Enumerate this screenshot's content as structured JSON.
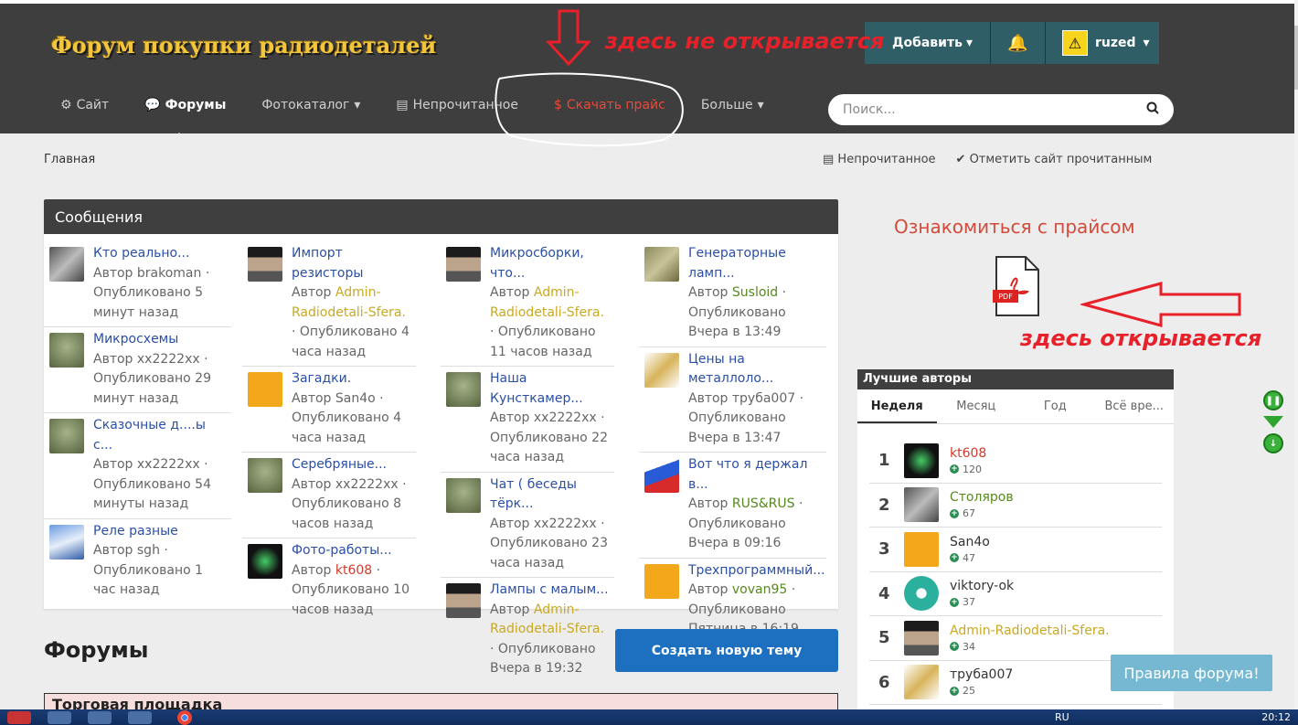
{
  "header": {
    "logo": "Форум покупки радиодеталей",
    "add_label": "Добавить",
    "username": "ruzed",
    "search_placeholder": "Поиск..."
  },
  "nav": {
    "items": [
      {
        "label": "Сайт",
        "icon": "gear-icon"
      },
      {
        "label": "Форумы",
        "icon": "comments-icon"
      },
      {
        "label": "Фотокаталог",
        "icon": "caret-down-icon"
      },
      {
        "label": "Непрочитанное",
        "icon": "newspaper-icon"
      },
      {
        "label": "Скачать прайс",
        "icon": "dollar-icon"
      },
      {
        "label": "Больше",
        "icon": "caret-down-icon"
      }
    ]
  },
  "annotations": {
    "top": "здесь не открывается",
    "bottom": "здесь открывается"
  },
  "breadcrumb": "Главная",
  "top_actions": {
    "unread": "Непрочитанное",
    "mark_read": "Отметить сайт прочитанным"
  },
  "messages": {
    "title": "Сообщения",
    "columns": [
      [
        {
          "title": "Кто реально...",
          "pre": "Автор ",
          "author": "brakoman",
          "authorClass": "",
          "time": " · Опубликовано 5 минут назад",
          "thumb": "t-grey"
        },
        {
          "title": "Микросхемы",
          "pre": "Автор ",
          "author": "xx2222xx",
          "authorClass": "",
          "time": " · Опубликовано 29 минут назад",
          "thumb": "t-can"
        },
        {
          "title": "Сказочные д....ы с...",
          "pre": "Автор ",
          "author": "xx2222xx",
          "authorClass": "",
          "time": " · Опубликовано 54 минуты назад",
          "thumb": "t-can"
        },
        {
          "title": "Реле разные",
          "pre": "Автор ",
          "author": "sgh",
          "authorClass": "",
          "time": " · Опубликовано 1 час назад",
          "thumb": "t-blue"
        }
      ],
      [
        {
          "title": "Импорт резисторы",
          "pre": "Автор ",
          "author": "Admin-Radiodetali-Sfera.",
          "authorClass": "author-admin",
          "time": " · Опубликовано 4 часа назад",
          "thumb": "t-man"
        },
        {
          "title": "Загадки.",
          "pre": "Автор ",
          "author": "San4o",
          "authorClass": "",
          "time": " · Опубликовано 4 часа назад",
          "thumb": "t-q"
        },
        {
          "title": "Серебряные...",
          "pre": "Автор ",
          "author": "xx2222xx",
          "authorClass": "",
          "time": " · Опубликовано 8 часов назад",
          "thumb": "t-can"
        },
        {
          "title": "Фото-работы...",
          "pre": "Автор ",
          "author": "kt608",
          "authorClass": "author-red",
          "time": " · Опубликовано 10 часов назад",
          "thumb": "t-chip"
        }
      ],
      [
        {
          "title": "Микросборки, что...",
          "pre": "Автор ",
          "author": "Admin-Radiodetali-Sfera.",
          "authorClass": "author-admin",
          "time": " · Опубликовано 11 часов назад",
          "thumb": "t-man"
        },
        {
          "title": "Наша Кунсткамер...",
          "pre": "Автор ",
          "author": "xx2222xx",
          "authorClass": "",
          "time": " · Опубликовано 22 часа назад",
          "thumb": "t-can"
        },
        {
          "title": "Чат ( беседы тёрк...",
          "pre": "Автор ",
          "author": "xx2222xx",
          "authorClass": "",
          "time": " · Опубликовано 23 часа назад",
          "thumb": "t-can"
        },
        {
          "title": "Лампы с малым...",
          "pre": "Автор ",
          "author": "Admin-Radiodetali-Sfera.",
          "authorClass": "author-admin",
          "time": " · Опубликовано Вчера в 19:32",
          "thumb": "t-man"
        }
      ],
      [
        {
          "title": "Генераторные ламп...",
          "pre": "Автор ",
          "author": "Susloid",
          "authorClass": "author-green",
          "time": " · Опубликовано Вчера в 13:49",
          "thumb": "t-mod"
        },
        {
          "title": "Цены на металлоло...",
          "pre": "Автор ",
          "author": "труба007",
          "authorClass": "",
          "time": " · Опубликовано Вчера в 13:47",
          "thumb": "t-horn"
        },
        {
          "title": "Вот что я держал в...",
          "pre": "Автор ",
          "author": "RUS&RUS",
          "authorClass": "author-green",
          "time": " · Опубликовано Вчера в 09:16",
          "thumb": "t-flag"
        },
        {
          "title": "Трехпрограммный...",
          "pre": "Автор ",
          "author": "vovan95",
          "authorClass": "author-green",
          "time": " · Опубликовано Пятница в 16:19",
          "thumb": "t-q"
        }
      ]
    ]
  },
  "forums": {
    "title": "Форумы",
    "new_topic": "Создать новую тему",
    "first_section": "Торговая площадка"
  },
  "sidebar": {
    "price_link": "Ознакомиться с прайсом",
    "pdf_label": "PDF",
    "top_authors": "Лучшие авторы",
    "tabs": [
      "Неделя",
      "Месяц",
      "Год",
      "Всё вре..."
    ],
    "authors": [
      {
        "rank": "1",
        "name": "kt608",
        "score": "120",
        "color": "#d13b2b",
        "av": "t-chip"
      },
      {
        "rank": "2",
        "name": "Столяров",
        "score": "67",
        "color": "#56891f",
        "av": "t-grey"
      },
      {
        "rank": "3",
        "name": "San4o",
        "score": "47",
        "color": "#333",
        "av": "t-q"
      },
      {
        "rank": "4",
        "name": "viktory-ok",
        "score": "37",
        "color": "#333",
        "av": "av-teal"
      },
      {
        "rank": "5",
        "name": "Admin-Radiodetali-Sfera.",
        "score": "34",
        "color": "#c8a921",
        "av": "t-man"
      },
      {
        "rank": "6",
        "name": "труба007",
        "score": "25",
        "color": "#333",
        "av": "t-horn"
      }
    ]
  },
  "rules_button": "Правила форума!",
  "taskbar": {
    "lang": "RU",
    "time": "20:12"
  }
}
